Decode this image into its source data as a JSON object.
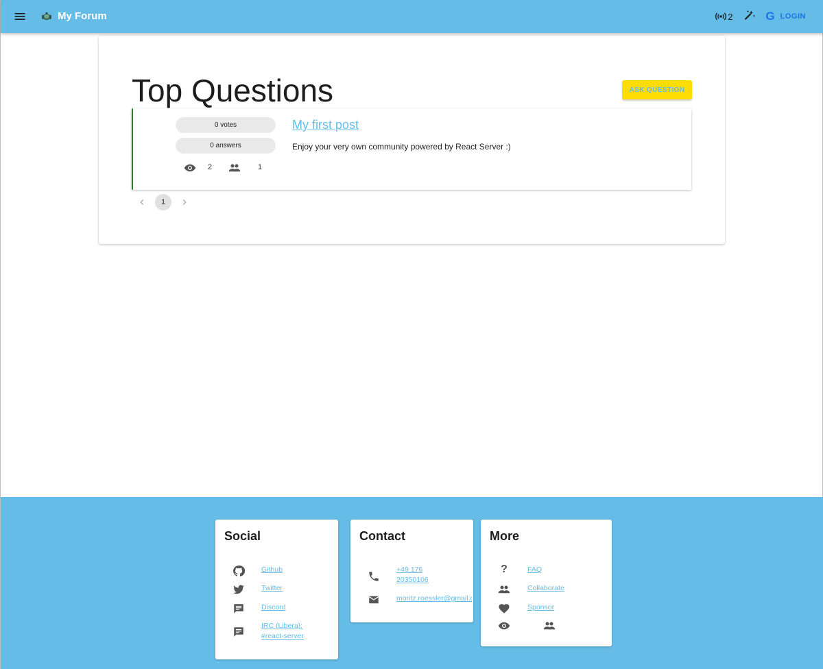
{
  "app": {
    "title": "My Forum",
    "online_count": "2",
    "login_label": "LOGIN",
    "google_glyph": "G",
    "icons": [
      "menu-icon",
      "forum-logo-icon",
      "online-users-icon",
      "magic-wand-icon",
      "google-icon"
    ]
  },
  "colors": {
    "primary": "#65bce6",
    "accent": "#ffdd00",
    "google_blue": "#1a73e8",
    "card_border": "#2e7d32"
  },
  "main": {
    "title": "Top Questions",
    "ask_button": "ASK QUESTION",
    "questions": [
      {
        "votes": "0 votes",
        "answers": "0 answers",
        "views": "2",
        "participants": "1",
        "title": "My first post",
        "description": "Enjoy your very own community powered by React Server :)"
      }
    ],
    "pagination": {
      "current_page": "1"
    }
  },
  "footer": {
    "social": {
      "title": "Social",
      "links": [
        {
          "label": "Github",
          "icon": "github-icon"
        },
        {
          "label": "Twitter",
          "icon": "twitter-icon"
        },
        {
          "label": "Discord",
          "icon": "chat-icon"
        },
        {
          "label": "IRC (Libera): #react-server",
          "icon": "chat-icon"
        }
      ]
    },
    "contact": {
      "title": "Contact",
      "phone": "+49 176 20350106",
      "email": "moritz.roessler@gmail.com"
    },
    "more": {
      "title": "More",
      "qmark": "?",
      "links": [
        {
          "label": "FAQ",
          "icon": "help-icon"
        },
        {
          "label": "Collaborate",
          "icon": "people-icon"
        },
        {
          "label": "Sponsor",
          "icon": "heart-icon"
        }
      ]
    }
  }
}
